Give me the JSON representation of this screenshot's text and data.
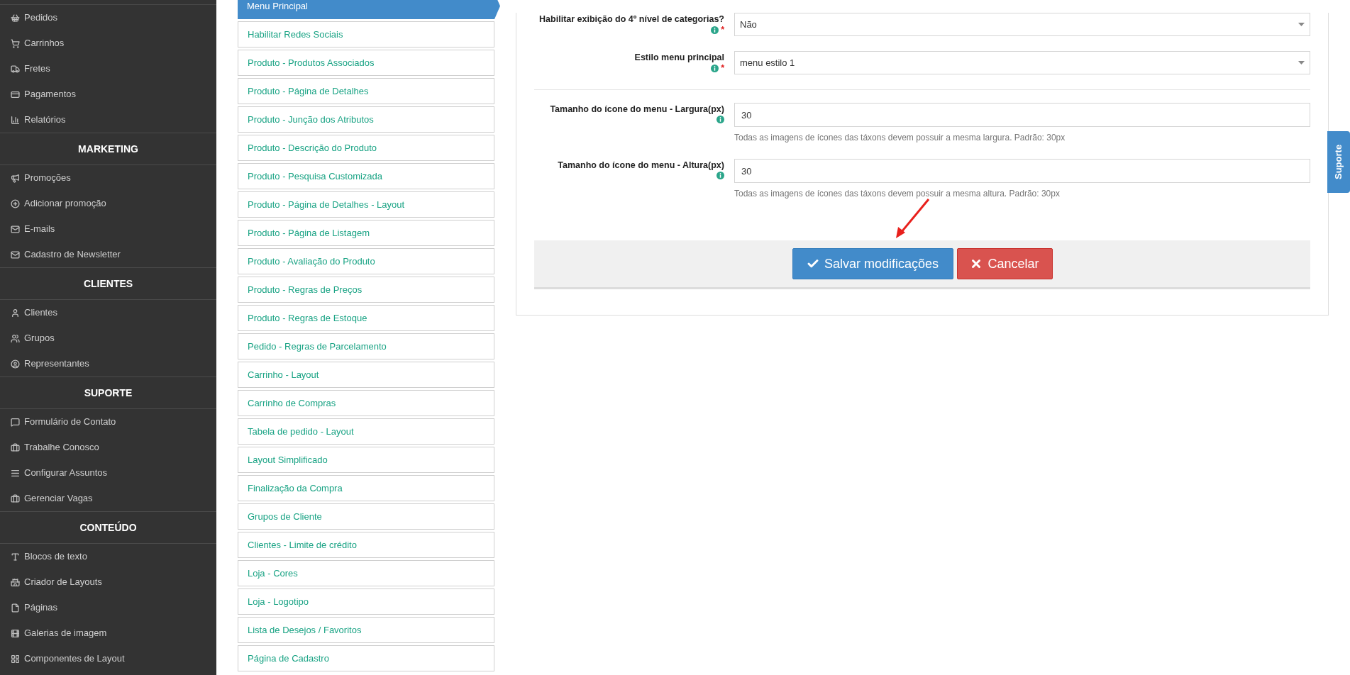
{
  "sidebar": {
    "sections": [
      {
        "items": [
          "Pedidos",
          "Carrinhos",
          "Fretes",
          "Pagamentos",
          "Relatórios"
        ]
      },
      {
        "heading": "MARKETING",
        "items": [
          "Promoções",
          "Adicionar promoção",
          "E-mails",
          "Cadastro de Newsletter"
        ]
      },
      {
        "heading": "CLIENTES",
        "items": [
          "Clientes",
          "Grupos",
          "Representantes"
        ]
      },
      {
        "heading": "SUPORTE",
        "items": [
          "Formulário de Contato",
          "Trabalhe Conosco",
          "Configurar Assuntos",
          "Gerenciar Vagas"
        ]
      },
      {
        "heading": "CONTEÚDO",
        "items": [
          "Blocos de texto",
          "Criador de Layouts",
          "Páginas",
          "Galerias de imagem",
          "Componentes de Layout"
        ]
      }
    ]
  },
  "settings_menu": [
    {
      "label": "Menu Principal",
      "selected": true
    },
    {
      "label": "Habilitar Redes Sociais",
      "selected": false
    },
    {
      "label": "Produto - Produtos Associados",
      "selected": false
    },
    {
      "label": "Produto - Página de Detalhes",
      "selected": false
    },
    {
      "label": "Produto - Junção dos Atributos",
      "selected": false
    },
    {
      "label": "Produto - Descrição do Produto",
      "selected": false
    },
    {
      "label": "Produto - Pesquisa Customizada",
      "selected": false
    },
    {
      "label": "Produto - Página de Detalhes - Layout",
      "selected": false
    },
    {
      "label": "Produto - Página de Listagem",
      "selected": false
    },
    {
      "label": "Produto - Avaliação do Produto",
      "selected": false
    },
    {
      "label": "Produto - Regras de Preços",
      "selected": false
    },
    {
      "label": "Produto - Regras de Estoque",
      "selected": false
    },
    {
      "label": "Pedido - Regras de Parcelamento",
      "selected": false
    },
    {
      "label": "Carrinho - Layout",
      "selected": false
    },
    {
      "label": "Carrinho de Compras",
      "selected": false
    },
    {
      "label": "Tabela de pedido - Layout",
      "selected": false
    },
    {
      "label": "Layout Simplificado",
      "selected": false
    },
    {
      "label": "Finalização da Compra",
      "selected": false
    },
    {
      "label": "Grupos de Cliente",
      "selected": false
    },
    {
      "label": "Clientes - Limite de crédito",
      "selected": false
    },
    {
      "label": "Loja - Cores",
      "selected": false
    },
    {
      "label": "Loja - Logotipo",
      "selected": false
    },
    {
      "label": "Lista de Desejos / Favoritos",
      "selected": false
    },
    {
      "label": "Página de Cadastro",
      "selected": false
    }
  ],
  "form": {
    "groups": [
      [
        {
          "kind": "select",
          "label": "Habilitar exibição do 4º nível de categorias?",
          "required_mark": "*",
          "value": "Não"
        },
        {
          "kind": "select",
          "label": "Estilo menu principal",
          "required_mark": "*",
          "value": "menu estilo 1"
        }
      ],
      [
        {
          "kind": "text",
          "label": "Tamanho do ícone do menu - Largura(px)",
          "value": "30",
          "help": "Todas as imagens de ícones das táxons devem possuir a mesma largura. Padrão: 30px"
        },
        {
          "kind": "text",
          "label": "Tamanho do ícone do menu - Altura(px)",
          "value": "30",
          "help": "Todas as imagens de ícones das táxons devem possuir a mesma altura. Padrão: 30px"
        }
      ]
    ],
    "buttons": [
      {
        "kind": "save",
        "label": "Salvar modificações"
      },
      {
        "kind": "cancel",
        "label": "Cancelar"
      }
    ]
  },
  "support_tab": "Suporte"
}
